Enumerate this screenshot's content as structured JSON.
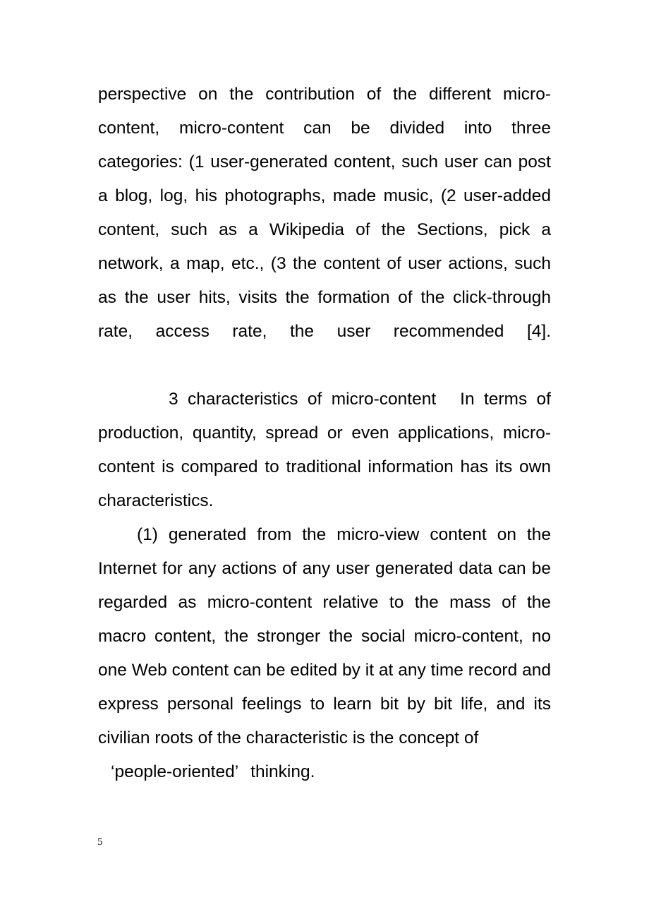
{
  "document": {
    "page_number": "5",
    "paragraphs": [
      {
        "id": "p1",
        "text": "perspective on the contribution of the different micro-content, micro-content can be divided into three categories: (1 user-generated content, such user can post a blog, log, his photographs, made music, (2 user-added content, such as a Wikipedia of the Sections, pick a network, a map, etc., (3 the content of user actions, such as the user hits, visits the formation of the click-through rate, access rate, the user recommended [4]."
      },
      {
        "id": "p2",
        "heading": "3 characteristics of micro-content",
        "text": "In terms of production, quantity, spread or even applications, micro-content is compared to traditional information has its own characteristics."
      },
      {
        "id": "p3",
        "text": "(1) generated from the micro-view content on the Internet for any actions of any user generated data can be regarded as micro-content relative to the mass of the macro content, the stronger the social micro-content, no one Web content can be edited by it at any time record and express personal feelings to learn bit by bit life, and its civilian roots of the characteristic is the concept of",
        "tail": "‘people-oriented’"
      },
      {
        "id": "p3-tail-word",
        "text": "thinking."
      }
    ]
  }
}
